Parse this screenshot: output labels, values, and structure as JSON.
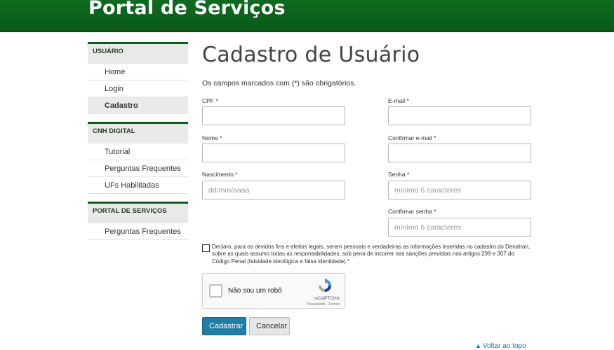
{
  "header": {
    "title": "Portal de Serviços"
  },
  "sidebar": {
    "sections": [
      {
        "title": "USUÁRIO",
        "items": [
          "Home",
          "Login",
          "Cadastro"
        ],
        "active": "Cadastro"
      },
      {
        "title": "CNH DIGITAL",
        "items": [
          "Tutorial",
          "Perguntas Frequentes",
          "UFs Habilitadas"
        ]
      },
      {
        "title": "PORTAL DE SERVIÇOS",
        "items": [
          "Perguntas Frequentes"
        ]
      }
    ]
  },
  "main": {
    "title": "Cadastro de Usuário",
    "required_note": "Os campos marcados com (*) são obrigatórios.",
    "fields": {
      "cpf": {
        "label": "CPF *",
        "value": "",
        "placeholder": ""
      },
      "email": {
        "label": "E-mail *",
        "value": "",
        "placeholder": ""
      },
      "nome": {
        "label": "Nome *",
        "value": "",
        "placeholder": ""
      },
      "confirm_email": {
        "label": "Confirmar e-mail *",
        "value": "",
        "placeholder": ""
      },
      "nascimento": {
        "label": "Nascimento *",
        "value": "",
        "placeholder": "dd/mm/aaaa"
      },
      "senha": {
        "label": "Senha *",
        "value": "",
        "placeholder": "mínimo 6 caracteres"
      },
      "confirm_senha": {
        "label": "Confirmar senha *",
        "value": "",
        "placeholder": "mínimo 6 caracteres"
      }
    },
    "declaration": "Declaro, para os devidos fins e efeitos legais, serem pessoais e verdadeiras as informações inseridas no cadastro do Denatran, sobre as quais assumo todas as responsabilidades, sob pena de incorrer nas sanções previstas nos artigos 299 e 307 do Código Penal (falsidade ideológica e falsa identidade).*",
    "captcha": {
      "label": "Não sou um robô",
      "brand": "reCAPTCHA",
      "links": "Privacidade - Termos"
    },
    "buttons": {
      "submit": "Cadastrar",
      "cancel": "Cancelar"
    },
    "back_to_top": "Voltar ao topo"
  },
  "colors": {
    "header_green": "#0d6b1f",
    "primary_button": "#1f7ea5",
    "link": "#1f6fa8"
  }
}
